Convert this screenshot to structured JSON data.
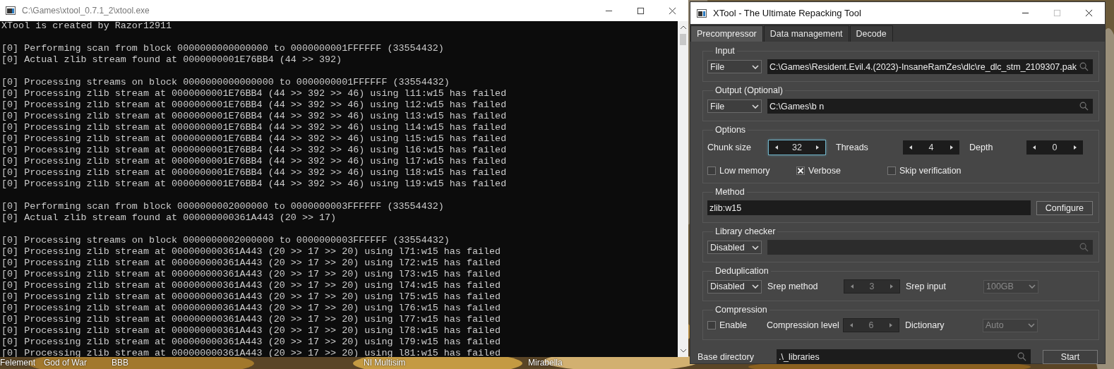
{
  "desktop_icons": [
    "Felement",
    "God of War",
    "BBB",
    "NI Multisim",
    "Mirabella"
  ],
  "console": {
    "title": "C:\\Games\\xtool_0.7.1_2\\xtool.exe",
    "blocks": [
      {
        "lines": [
          "XTool is created by Razor12911"
        ]
      },
      {
        "lines": [
          "[0] Performing scan from block 0000000000000000 to 0000000001FFFFFF (33554432)",
          "[0] Actual zlib stream found at 0000000001E76BB4 (44 >> 392)"
        ]
      },
      {
        "lines": [
          "[0] Processing streams on block 0000000000000000 to 0000000001FFFFFF (33554432)",
          "[0] Processing zlib stream at 0000000001E76BB4 (44 >> 392 >> 46) using l11:w15 has failed",
          "[0] Processing zlib stream at 0000000001E76BB4 (44 >> 392 >> 46) using l12:w15 has failed",
          "[0] Processing zlib stream at 0000000001E76BB4 (44 >> 392 >> 46) using l13:w15 has failed",
          "[0] Processing zlib stream at 0000000001E76BB4 (44 >> 392 >> 46) using l14:w15 has failed",
          "[0] Processing zlib stream at 0000000001E76BB4 (44 >> 392 >> 46) using l15:w15 has failed",
          "[0] Processing zlib stream at 0000000001E76BB4 (44 >> 392 >> 46) using l16:w15 has failed",
          "[0] Processing zlib stream at 0000000001E76BB4 (44 >> 392 >> 46) using l17:w15 has failed",
          "[0] Processing zlib stream at 0000000001E76BB4 (44 >> 392 >> 46) using l18:w15 has failed",
          "[0] Processing zlib stream at 0000000001E76BB4 (44 >> 392 >> 46) using l19:w15 has failed"
        ]
      },
      {
        "lines": [
          "[0] Performing scan from block 0000000002000000 to 0000000003FFFFFF (33554432)",
          "[0] Actual zlib stream found at 000000000361A443 (20 >> 17)"
        ]
      },
      {
        "lines": [
          "[0] Processing streams on block 0000000002000000 to 0000000003FFFFFF (33554432)",
          "[0] Processing zlib stream at 000000000361A443 (20 >> 17 >> 20) using l71:w15 has failed",
          "[0] Processing zlib stream at 000000000361A443 (20 >> 17 >> 20) using l72:w15 has failed",
          "[0] Processing zlib stream at 000000000361A443 (20 >> 17 >> 20) using l73:w15 has failed",
          "[0] Processing zlib stream at 000000000361A443 (20 >> 17 >> 20) using l74:w15 has failed",
          "[0] Processing zlib stream at 000000000361A443 (20 >> 17 >> 20) using l75:w15 has failed",
          "[0] Processing zlib stream at 000000000361A443 (20 >> 17 >> 20) using l76:w15 has failed",
          "[0] Processing zlib stream at 000000000361A443 (20 >> 17 >> 20) using l77:w15 has failed",
          "[0] Processing zlib stream at 000000000361A443 (20 >> 17 >> 20) using l78:w15 has failed",
          "[0] Processing zlib stream at 000000000361A443 (20 >> 17 >> 20) using l79:w15 has failed",
          "[0] Processing zlib stream at 000000000361A443 (20 >> 17 >> 20) using l81:w15 has failed"
        ]
      }
    ]
  },
  "xtool": {
    "title": "XTool - The Ultimate Repacking Tool",
    "tabs": [
      {
        "label": "Precompressor",
        "selected": true
      },
      {
        "label": "Data management",
        "selected": false
      },
      {
        "label": "Decode",
        "selected": false
      }
    ],
    "input": {
      "group": "Input",
      "mode": "File",
      "path": "C:\\Games\\Resident.Evil.4.(2023)-InsaneRamZes\\dlc\\re_dlc_stm_2109307.pak"
    },
    "output": {
      "group": "Output (Optional)",
      "mode": "File",
      "path": "C:\\Games\\b n"
    },
    "options": {
      "group": "Options",
      "spinners": [
        {
          "label": "Chunk size",
          "value": "32",
          "focused": true
        },
        {
          "label": "Threads",
          "value": "4",
          "focused": false
        },
        {
          "label": "Depth",
          "value": "0",
          "focused": false
        }
      ],
      "checkboxes": [
        {
          "label": "Low memory",
          "checked": false
        },
        {
          "label": "Verbose",
          "checked": true
        },
        {
          "label": "Skip verification",
          "checked": false
        }
      ]
    },
    "method": {
      "group": "Method",
      "value": "zlib:w15",
      "button": "Configure"
    },
    "library_checker": {
      "group": "Library checker",
      "mode": "Disabled"
    },
    "deduplication": {
      "group": "Deduplication",
      "mode": "Disabled",
      "spinner_label": "Srep method",
      "spinner_value": "3",
      "spinner_disabled": true,
      "select_label": "Srep input",
      "select_value": "100GB",
      "select_disabled": true
    },
    "compression": {
      "group": "Compression",
      "enable_label": "Enable",
      "enable_checked": false,
      "level_label": "Compression level",
      "level_value": "6",
      "level_disabled": true,
      "dictionary_label": "Dictionary",
      "dictionary_value": "Auto",
      "dictionary_disabled": true
    },
    "base_directory": {
      "label": "Base directory",
      "value": ".\\_libraries"
    },
    "start_button": "Start"
  }
}
